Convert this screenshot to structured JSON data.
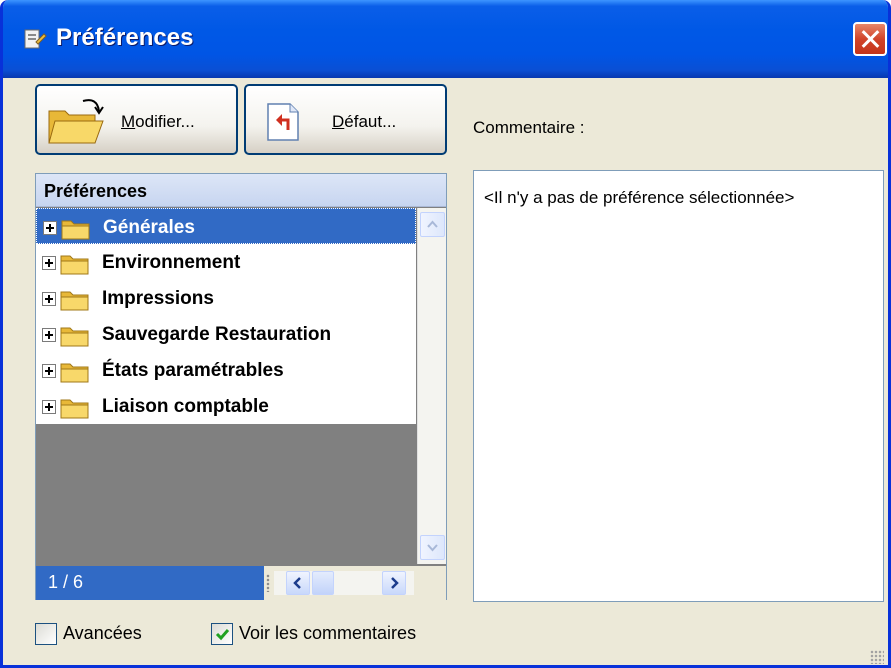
{
  "window": {
    "title": "Préférences"
  },
  "toolbar": {
    "modify_label_underline": "M",
    "modify_label_rest": "odifier...",
    "default_label_underline": "D",
    "default_label_rest": "éfaut..."
  },
  "comment": {
    "label": "Commentaire :",
    "text": "<Il n'y a pas de préférence sélectionnée>"
  },
  "tree": {
    "header": "Préférences",
    "items": [
      {
        "label": "Générales",
        "selected": true
      },
      {
        "label": "Environnement",
        "selected": false
      },
      {
        "label": "Impressions",
        "selected": false
      },
      {
        "label": "Sauvegarde Restauration",
        "selected": false
      },
      {
        "label": "États paramétrables",
        "selected": false
      },
      {
        "label": "Liaison comptable",
        "selected": false
      }
    ],
    "page_indicator": "1 / 6"
  },
  "options": {
    "advanced": {
      "label": "Avancées",
      "checked": false
    },
    "show_comments": {
      "label": "Voir les commentaires",
      "checked": true
    }
  },
  "colors": {
    "title_bar": "#0055e5",
    "selection": "#316ac5",
    "window_bg": "#ece9d8",
    "close_button": "#d1442a"
  }
}
